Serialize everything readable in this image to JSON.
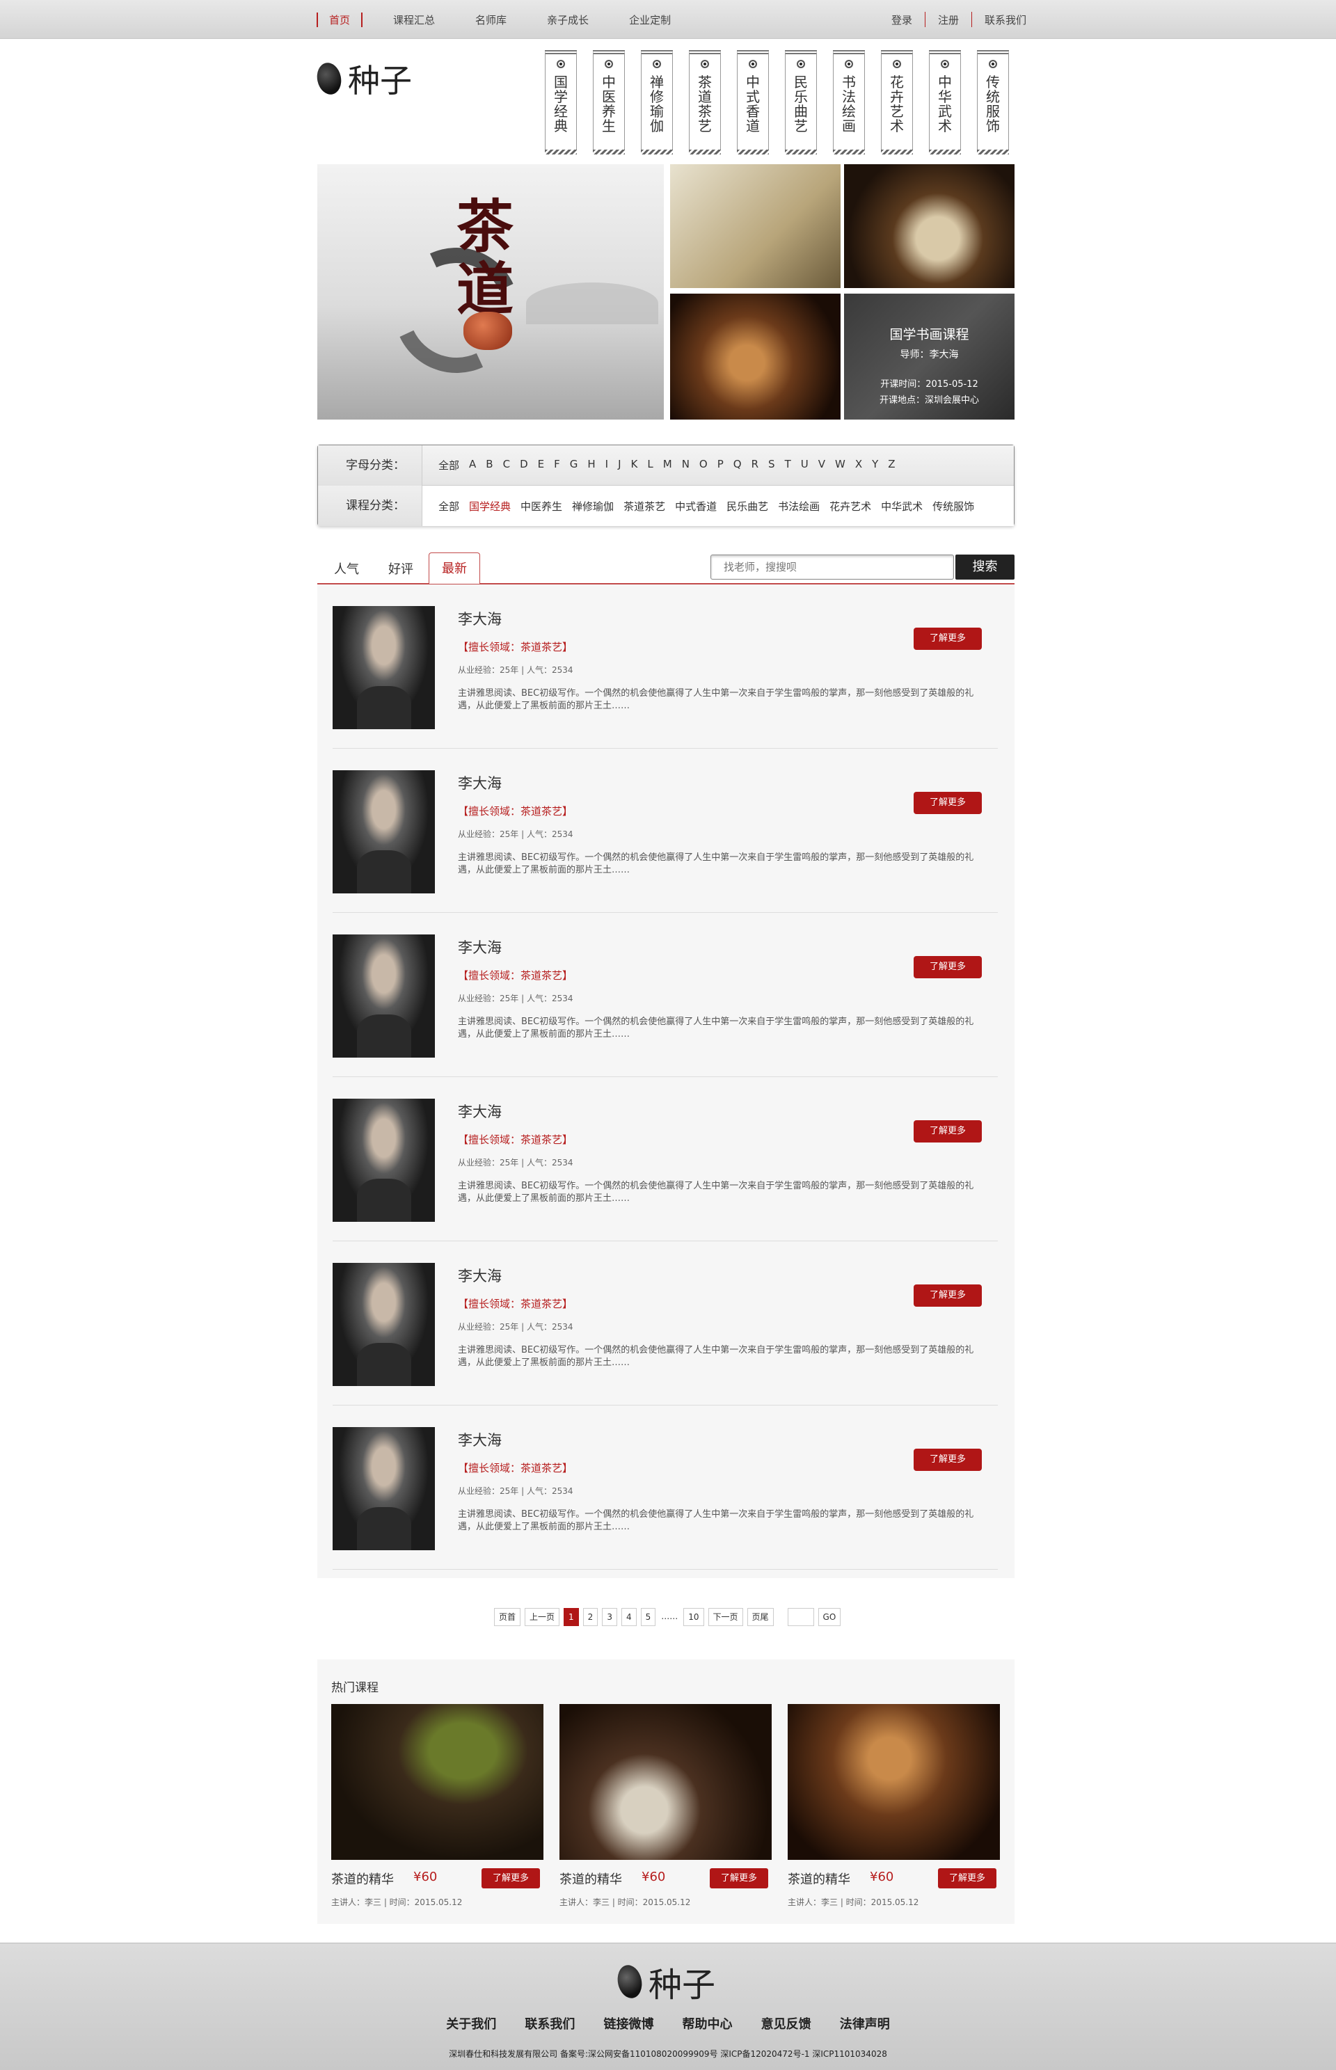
{
  "topnav": {
    "items": [
      "首页",
      "课程汇总",
      "名师库",
      "亲子成长",
      "企业定制"
    ],
    "login": "登录",
    "register": "注册",
    "contact": "联系我们"
  },
  "logo": {
    "text": "种子"
  },
  "scrolls": [
    "国学经典",
    "中医养生",
    "禅修瑜伽",
    "茶道茶艺",
    "中式香道",
    "民乐曲艺",
    "书法绘画",
    "花卉艺术",
    "中华武术",
    "传统服饰"
  ],
  "banner": {
    "main_text": "茶道",
    "course_title": "国学书画课程",
    "teacher": "导师：李大海",
    "time": "开课时间：2015-05-12",
    "place": "开课地点：深圳会展中心"
  },
  "filter": {
    "alpha_label": "字母分类：",
    "alpha_items": [
      "全部",
      "A",
      "B",
      "C",
      "D",
      "E",
      "F",
      "G",
      "H",
      "I",
      "J",
      "K",
      "L",
      "M",
      "N",
      "O",
      "P",
      "Q",
      "R",
      "S",
      "T",
      "U",
      "V",
      "W",
      "X",
      "Y",
      "Z"
    ],
    "course_label": "课程分类：",
    "course_items": [
      "全部",
      "国学经典",
      "中医养生",
      "禅修瑜伽",
      "茶道茶艺",
      "中式香道",
      "民乐曲艺",
      "书法绘画",
      "花卉艺术",
      "中华武术",
      "传统服饰"
    ],
    "course_active": "国学经典"
  },
  "tabs": [
    "人气",
    "好评",
    "最新"
  ],
  "search": {
    "placeholder": "找老师，搜搜呗",
    "button": "搜索"
  },
  "teachers": [
    {
      "name": "李大海",
      "field": "【擅长领域：茶道茶艺】",
      "exp": "从业经验：25年  |  人气：2534",
      "desc": "主讲雅思阅读、BEC初级写作。一个偶然的机会使他赢得了人生中第一次来自于学生雷鸣般的掌声，那一刻他感受到了英雄般的礼遇，从此便爱上了黑板前面的那片王土……",
      "button": "了解更多"
    },
    {
      "name": "李大海",
      "field": "【擅长领域：茶道茶艺】",
      "exp": "从业经验：25年  |  人气：2534",
      "desc": "主讲雅思阅读、BEC初级写作。一个偶然的机会使他赢得了人生中第一次来自于学生雷鸣般的掌声，那一刻他感受到了英雄般的礼遇，从此便爱上了黑板前面的那片王土……",
      "button": "了解更多"
    },
    {
      "name": "李大海",
      "field": "【擅长领域：茶道茶艺】",
      "exp": "从业经验：25年  |  人气：2534",
      "desc": "主讲雅思阅读、BEC初级写作。一个偶然的机会使他赢得了人生中第一次来自于学生雷鸣般的掌声，那一刻他感受到了英雄般的礼遇，从此便爱上了黑板前面的那片王土……",
      "button": "了解更多"
    },
    {
      "name": "李大海",
      "field": "【擅长领域：茶道茶艺】",
      "exp": "从业经验：25年  |  人气：2534",
      "desc": "主讲雅思阅读、BEC初级写作。一个偶然的机会使他赢得了人生中第一次来自于学生雷鸣般的掌声，那一刻他感受到了英雄般的礼遇，从此便爱上了黑板前面的那片王土……",
      "button": "了解更多"
    },
    {
      "name": "李大海",
      "field": "【擅长领域：茶道茶艺】",
      "exp": "从业经验：25年  |  人气：2534",
      "desc": "主讲雅思阅读、BEC初级写作。一个偶然的机会使他赢得了人生中第一次来自于学生雷鸣般的掌声，那一刻他感受到了英雄般的礼遇，从此便爱上了黑板前面的那片王土……",
      "button": "了解更多"
    },
    {
      "name": "李大海",
      "field": "【擅长领域：茶道茶艺】",
      "exp": "从业经验：25年  |  人气：2534",
      "desc": "主讲雅思阅读、BEC初级写作。一个偶然的机会使他赢得了人生中第一次来自于学生雷鸣般的掌声，那一刻他感受到了英雄般的礼遇，从此便爱上了黑板前面的那片王土……",
      "button": "了解更多"
    }
  ],
  "pager": {
    "first": "页首",
    "prev": "上一页",
    "pages": [
      "1",
      "2",
      "3",
      "4",
      "5"
    ],
    "ellipsis": "……",
    "last_num": "10",
    "next": "下一页",
    "end": "页尾",
    "go": "GO"
  },
  "hot": {
    "title": "热门课程",
    "cards": [
      {
        "name": "茶道的精华",
        "price": "¥60",
        "button": "了解更多",
        "meta": "主讲人：李三  |  时间：2015.05.12"
      },
      {
        "name": "茶道的精华",
        "price": "¥60",
        "button": "了解更多",
        "meta": "主讲人：李三  |  时间：2015.05.12"
      },
      {
        "name": "茶道的精华",
        "price": "¥60",
        "button": "了解更多",
        "meta": "主讲人：李三  |  时间：2015.05.12"
      }
    ]
  },
  "footer": {
    "links": [
      "关于我们",
      "联系我们",
      "链接微博",
      "帮助中心",
      "意见反馈",
      "法律声明"
    ],
    "copyright": "深圳春仕和科技发展有限公司    备案号:深公网安备110108020099909号 深ICP备12020472号-1 深ICP1101034028"
  },
  "colors": {
    "accent": "#b01616",
    "nav_active": "#b61e1e"
  }
}
